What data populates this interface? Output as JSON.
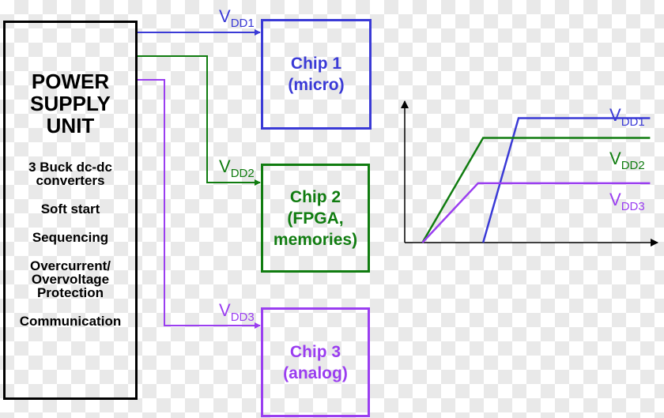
{
  "colors": {
    "vdd1": "#3a3ad6",
    "vdd2": "#107c10",
    "vdd3": "#9a3ef0",
    "ink": "#000000"
  },
  "psu": {
    "title_lines": [
      "POWER",
      "SUPPLY",
      "UNIT"
    ],
    "features": [
      [
        "3 Buck dc-dc",
        "converters"
      ],
      [
        "Soft start"
      ],
      [
        "Sequencing"
      ],
      [
        "Overcurrent/",
        "Overvoltage",
        "Protection"
      ],
      [
        "Communication"
      ]
    ]
  },
  "rails": [
    {
      "id": "vdd1",
      "label_main": "V",
      "label_sub": "DD1"
    },
    {
      "id": "vdd2",
      "label_main": "V",
      "label_sub": "DD2"
    },
    {
      "id": "vdd3",
      "label_main": "V",
      "label_sub": "DD3"
    }
  ],
  "chips": [
    {
      "id": "chip1",
      "lines": [
        "Chip 1",
        "(micro)"
      ],
      "rail": "vdd1"
    },
    {
      "id": "chip2",
      "lines": [
        "Chip 2",
        "(FPGA,",
        "memories)"
      ],
      "rail": "vdd2"
    },
    {
      "id": "chip3",
      "lines": [
        "Chip 3",
        "(analog)"
      ],
      "rail": "vdd3"
    }
  ],
  "chart_data": {
    "type": "line",
    "title": "",
    "xlabel": "",
    "ylabel": "",
    "x_ticks": [],
    "y_ticks": [],
    "xlim": [
      0,
      10
    ],
    "ylim": [
      0,
      5
    ],
    "grid": false,
    "legend": "inline-right",
    "series": [
      {
        "name": "VDD1",
        "label_main": "V",
        "label_sub": "DD1",
        "color_key": "vdd1",
        "points": [
          [
            0,
            0
          ],
          [
            3.1,
            0
          ],
          [
            4.5,
            4.4
          ],
          [
            9.7,
            4.4
          ]
        ],
        "start_visible_index": 1
      },
      {
        "name": "VDD2",
        "label_main": "V",
        "label_sub": "DD2",
        "color_key": "vdd2",
        "points": [
          [
            0,
            0
          ],
          [
            0.7,
            0
          ],
          [
            3.1,
            3.7
          ],
          [
            9.7,
            3.7
          ]
        ],
        "start_visible_index": 1
      },
      {
        "name": "VDD3",
        "label_main": "V",
        "label_sub": "DD3",
        "color_key": "vdd3",
        "points": [
          [
            0,
            0
          ],
          [
            0.7,
            0
          ],
          [
            2.9,
            2.1
          ],
          [
            9.7,
            2.1
          ]
        ],
        "start_visible_index": 1
      }
    ]
  }
}
